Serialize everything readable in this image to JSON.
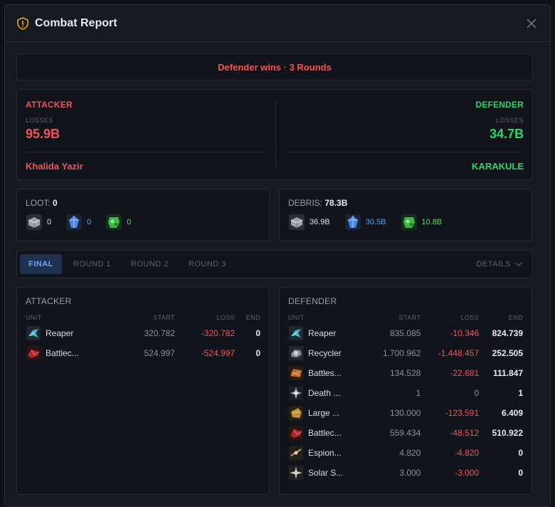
{
  "window": {
    "title": "Combat Report",
    "accent": "#f0a020"
  },
  "banner": {
    "text": "Defender wins · 3 Rounds"
  },
  "attacker": {
    "role": "ATTACKER",
    "losses_label": "LOSSES",
    "losses": "95.9B",
    "name": "Khalida Yazir"
  },
  "defender": {
    "role": "DEFENDER",
    "losses_label": "LOSSES",
    "losses": "34.7B",
    "name": "KARAKULE"
  },
  "loot": {
    "label": "LOOT:",
    "total": "0",
    "metal": "0",
    "crystal": "0",
    "deuterium": "0"
  },
  "debris": {
    "label": "DEBRIS:",
    "total": "78.3B",
    "metal": "36.9B",
    "crystal": "30.5B",
    "deuterium": "10.8B"
  },
  "tabs": [
    "FINAL",
    "ROUND 1",
    "ROUND 2",
    "ROUND 3"
  ],
  "details_label": "DETAILS",
  "columns": {
    "unit": "UNIT",
    "start": "START",
    "loss": "LOSS",
    "end": "END"
  },
  "attacker_units": {
    "title": "ATTACKER",
    "rows": [
      {
        "icon": "reaper-icon",
        "name": "Reaper",
        "start": "320.782",
        "loss": "-320.782",
        "end": "0"
      },
      {
        "icon": "battlecruiser-icon",
        "name": "Battlec...",
        "start": "524.997",
        "loss": "-524.997",
        "end": "0"
      }
    ]
  },
  "defender_units": {
    "title": "DEFENDER",
    "rows": [
      {
        "icon": "reaper-icon",
        "name": "Reaper",
        "start": "835.085",
        "loss": "-10.346",
        "end": "824.739"
      },
      {
        "icon": "recycler-icon",
        "name": "Recycler",
        "start": "1.700.962",
        "loss": "-1.448.457",
        "end": "252.505"
      },
      {
        "icon": "battleship-icon",
        "name": "Battles...",
        "start": "134.528",
        "loss": "-22.681",
        "end": "111.847"
      },
      {
        "icon": "deathstar-icon",
        "name": "Death ...",
        "start": "1",
        "loss": "0",
        "end": "1"
      },
      {
        "icon": "large-cargo-icon",
        "name": "Large ...",
        "start": "130.000",
        "loss": "-123.591",
        "end": "6.409"
      },
      {
        "icon": "battlecruiser-icon",
        "name": "Battlec...",
        "start": "559.434",
        "loss": "-48.512",
        "end": "510.922"
      },
      {
        "icon": "espionage-probe-icon",
        "name": "Espion...",
        "start": "4.820",
        "loss": "-4.820",
        "end": "0"
      },
      {
        "icon": "solar-satellite-icon",
        "name": "Solar S...",
        "start": "3.000",
        "loss": "-3.000",
        "end": "0"
      }
    ]
  }
}
